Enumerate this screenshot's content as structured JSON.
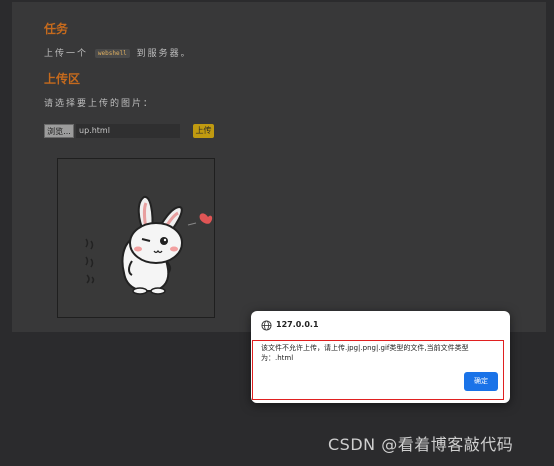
{
  "page": {
    "task_title": "任务",
    "task_prefix": "上传一个",
    "task_code": "webshell",
    "task_suffix": "到服务器。",
    "upload_title": "上传区",
    "upload_prompt": "请选择要上传的图片：",
    "browse_label": "浏览...",
    "file_name": "up.html",
    "upload_button": "上传"
  },
  "dialog": {
    "origin": "127.0.0.1",
    "message": "该文件不允许上传，请上传.jpg|.png|.gif类型的文件,当前文件类型为：.html",
    "ok_label": "确定"
  },
  "watermark": "CSDN @看着博客敲代码",
  "colors": {
    "section_title": "#c56a1d",
    "upload_button": "#c09a10",
    "ok_button": "#1a73e8",
    "highlight": "#e02020"
  }
}
